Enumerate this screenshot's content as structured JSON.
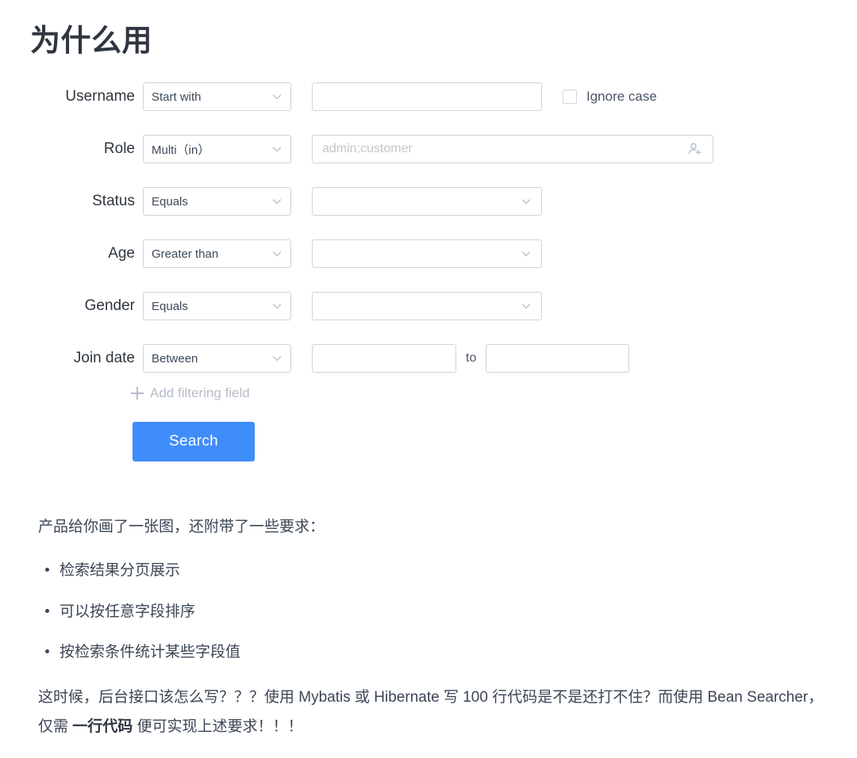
{
  "heading": "为什么用",
  "form": {
    "rows": [
      {
        "label": "Username",
        "operator": "Start with",
        "value_placeholder": "",
        "value_text": "",
        "checkbox_label": "Ignore case",
        "checkbox_checked": false
      },
      {
        "label": "Role",
        "operator": "Multi（in）",
        "value_placeholder": "admin;customer",
        "value_text": "",
        "icon": "user-add-icon"
      },
      {
        "label": "Status",
        "operator": "Equals",
        "value_placeholder": "",
        "value_text": ""
      },
      {
        "label": "Age",
        "operator": "Greater than",
        "value_placeholder": "",
        "value_text": ""
      },
      {
        "label": "Gender",
        "operator": "Equals",
        "value_placeholder": "",
        "value_text": ""
      },
      {
        "label": "Join date",
        "operator": "Between",
        "value_text": "",
        "separator": "to",
        "value_text_2": ""
      }
    ],
    "add_field_label": "Add filtering field",
    "add_field_icon": "plus-icon",
    "submit_label": "Search",
    "submit_color": "#3f8cfb"
  },
  "prose": {
    "intro": "产品给你画了一张图，还附带了一些要求：",
    "bullets": [
      "检索结果分页展示",
      "可以按任意字段排序",
      "按检索条件统计某些字段值"
    ],
    "closing": {
      "part1": "这时候，后台接口该怎么写？？？使用 Mybatis 或 Hibernate 写 100 行代码是不是还打不住？而使用 Bean Searcher，仅需 ",
      "bold": "一行代码",
      "part2": " 便可实现上述要求！！！"
    }
  }
}
